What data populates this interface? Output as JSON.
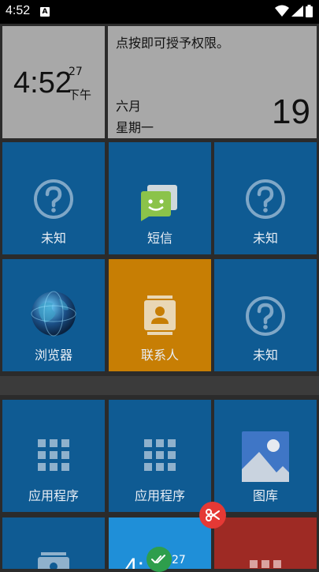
{
  "status_bar": {
    "time": "4:52",
    "notification_badge": "A",
    "icons": [
      "wifi-icon",
      "signal-icon",
      "battery-icon"
    ]
  },
  "clock_tile": {
    "time": "4:52",
    "seconds": "27",
    "ampm": "下午"
  },
  "calendar_tile": {
    "message": "点按即可授予权限。",
    "month": "六月",
    "weekday": "星期一",
    "day": "19"
  },
  "tiles": {
    "unknown1": "未知",
    "sms": "短信",
    "unknown2": "未知",
    "browser": "浏览器",
    "contacts": "联系人",
    "unknown3": "未知",
    "apps1": "应用程序",
    "apps2": "应用程序",
    "gallery": "图库"
  },
  "bottom_clock": {
    "time": "4:",
    "seconds": "27"
  },
  "colors": {
    "tile_blue": "#0f5b93",
    "tile_orange": "#c77e04",
    "tile_gray": "#a8a8a8",
    "cut_red": "#e53935",
    "check_green": "#2e9e4c"
  }
}
